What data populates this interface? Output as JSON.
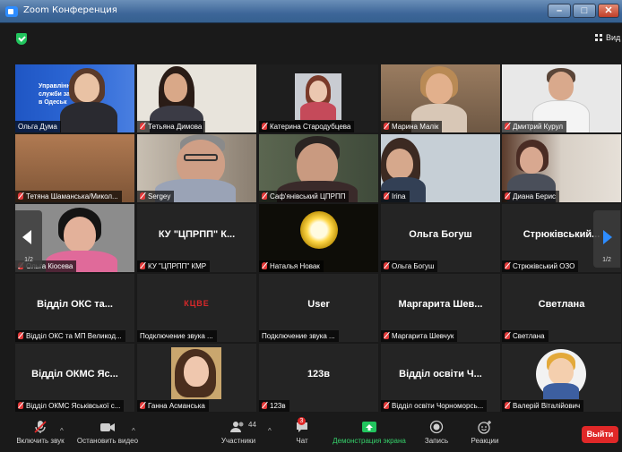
{
  "window": {
    "title": "Zoom Конференция"
  },
  "topbar": {
    "view_label": "Вид"
  },
  "tiles": [
    {
      "label": "Ольга Дума",
      "display": "",
      "muted": false
    },
    {
      "label": "Тетьяна Димова",
      "display": "",
      "muted": true
    },
    {
      "label": "Катерина Стародубцева",
      "display": "",
      "muted": true
    },
    {
      "label": "Марина Малік",
      "display": "",
      "muted": true
    },
    {
      "label": "Дмитрий Курул",
      "display": "",
      "muted": true
    },
    {
      "label": "Тетяна Шаманська/Микол...",
      "display": "",
      "muted": true
    },
    {
      "label": "Sergey",
      "display": "",
      "muted": true
    },
    {
      "label": "Саф'янівський ЦПРПП",
      "display": "",
      "muted": true
    },
    {
      "label": "Irina",
      "display": "",
      "muted": true
    },
    {
      "label": "Диана Берис",
      "display": "",
      "muted": true
    },
    {
      "label": "Ольга Кіосева",
      "display": "",
      "muted": true
    },
    {
      "label": "КУ \"ЦПРПП\" КМР",
      "display": "КУ \"ЦПРПП\" К...",
      "muted": true
    },
    {
      "label": "Наталья Новак",
      "display": "",
      "muted": true
    },
    {
      "label": "Ольга Богуш",
      "display": "Ольга Богуш",
      "muted": true
    },
    {
      "label": "Стрюківський ОЗО",
      "display": "Стрюківський...",
      "muted": true
    },
    {
      "label": "Відділ ОКС та МП Великод...",
      "display": "Відділ ОКС та...",
      "muted": true
    },
    {
      "label": "Подключение звука ...",
      "display": "",
      "muted": false
    },
    {
      "label": "Подключение звука ...",
      "display": "User",
      "muted": false
    },
    {
      "label": "Маргарита Шевчук",
      "display": "Маргарита Шев...",
      "muted": true
    },
    {
      "label": "Светлана",
      "display": "Светлана",
      "muted": true
    },
    {
      "label": "Відділ ОКМС Яськівської с...",
      "display": "Відділ ОКМС Яс...",
      "muted": true
    },
    {
      "label": "Ганна Асманська",
      "display": "",
      "muted": true
    },
    {
      "label": "123в",
      "display": "123в",
      "muted": true
    },
    {
      "label": "Відділ освіти Чорноморсь...",
      "display": "Відділ освіти Ч...",
      "muted": true
    },
    {
      "label": "Валерій Віталійович",
      "display": "",
      "muted": true
    }
  ],
  "tile1_overlay": {
    "line1": "Управління",
    "line2": "служби за",
    "line3": "в Одеськ"
  },
  "tile17_logo": "КЦВЕ",
  "pager": {
    "left": "1/2",
    "right": "1/2"
  },
  "toolbar": {
    "unmute": "Включить звук",
    "start_video": "Остановить видео",
    "participants": "Участники",
    "participants_count": "44",
    "chat": "Чат",
    "chat_badge": "3",
    "share": "Демонстрация экрана",
    "record": "Запись",
    "reactions": "Реакции",
    "leave": "Выйти"
  },
  "colors": {
    "accent": "#2d8cff",
    "leave": "#e02828",
    "active_speaker": "#f5e642",
    "share_green": "#22c55e"
  }
}
